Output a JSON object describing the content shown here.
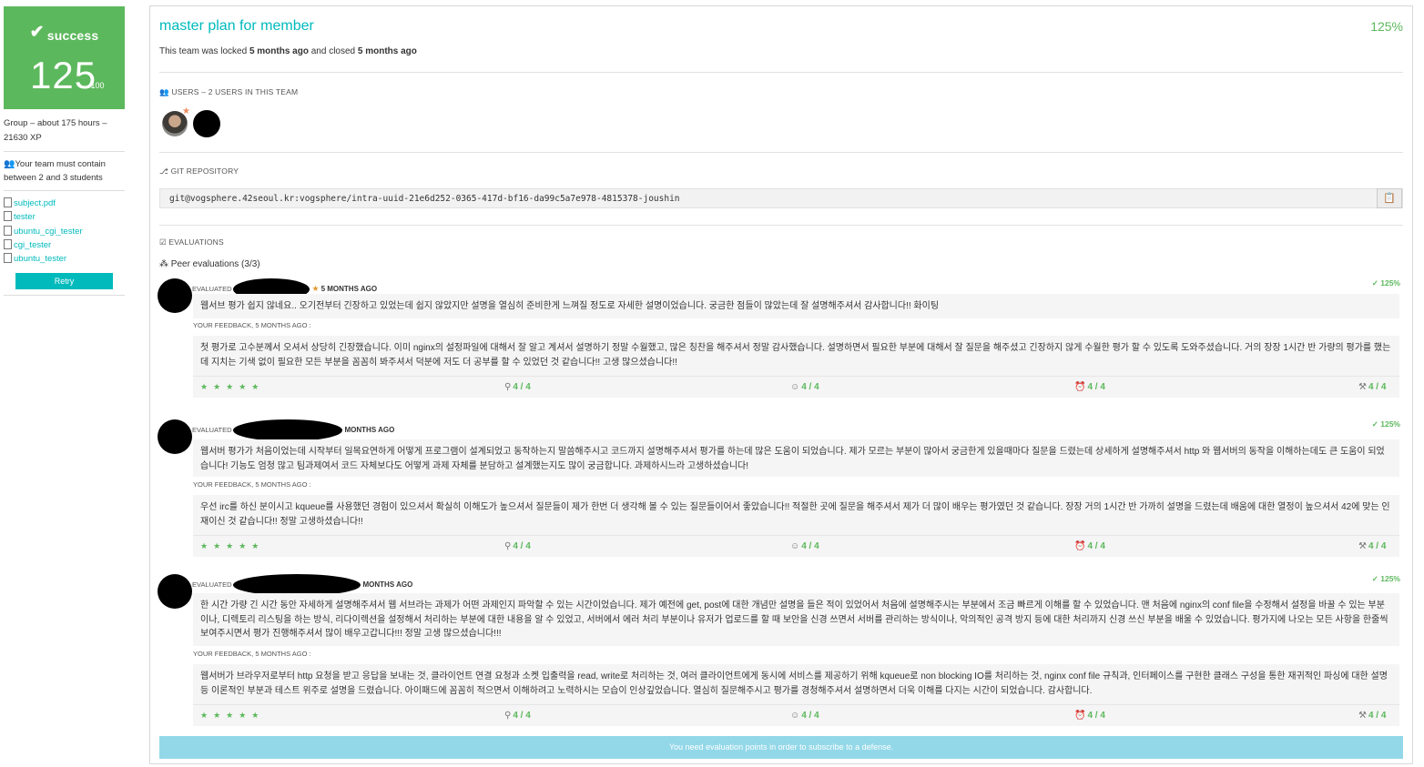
{
  "sidebar": {
    "status": "success",
    "score": "125",
    "score_max": "/100",
    "group_info": "Group – about 175 hours – 21630 XP",
    "team_rule": "Your team must contain between 2 and 3 students",
    "files": [
      "subject.pdf",
      "tester",
      "ubuntu_cgi_tester",
      "cgi_tester",
      "ubuntu_tester"
    ],
    "retry_label": "Retry",
    "colors": {
      "success": "#5cb85c",
      "accent": "#00babc"
    }
  },
  "main": {
    "title": "master plan for member",
    "score": "125%",
    "lock_prefix": "This team was locked ",
    "lock_time": "5 months ago",
    "lock_mid": " and closed ",
    "close_time": "5 months ago",
    "users_label": "USERS – 2 USERS IN THIS TEAM",
    "git_label": "GIT REPOSITORY",
    "git_url": "git@vogsphere.42seoul.kr:vogsphere/intra-uuid-21e6d252-0365-417d-bf16-da99c5a7e978-4815378-joushin",
    "evaluations_label": "EVALUATIONS",
    "peer_title": "Peer evaluations (3/3)",
    "notice": "You need evaluation points in order to subscribe to a defense."
  },
  "evaluations": [
    {
      "header_prefix": "EVALUATED",
      "time": "5 MONTHS AGO",
      "score": "125%",
      "comment": "웹서브 평가 쉽지 않네요.. 오기전부터 긴장하고 있었는데 쉽지 않았지만 설명을 열심히 준비한게 느껴질 정도로 자세한 설명이었습니다. 궁금한 점들이 많았는데 잘 설명해주셔서 감사합니다!! 화이팅",
      "feedback_label": "YOUR FEEDBACK, 5 MONTHS AGO :",
      "feedback": "첫 평가로 고수분께서 오셔서 상당히 긴장했습니다. 이미 nginx의 설정파일에 대해서 잘 알고 계셔서 설명하기 정말 수월했고, 많은 칭찬을 해주셔서 정말 감사했습니다. 설명하면서 필요한 부분에 대해서 잘 질문을 해주셨고 긴장하지 않게 수월한 평가 할 수 있도록 도와주셨습니다. 거의 장장 1시간 반 가량의 평가를 했는데 지치는 기색 없이 필요한 모든 부분을 꼼꼼히 봐주셔서 덕분에 저도 더 공부를 할 수 있었던 것 같습니다!! 고생 많으셨습니다!!",
      "stars": "★★★★★",
      "ratings": [
        "4 / 4",
        "4 / 4",
        "4 / 4",
        "4 / 4"
      ]
    },
    {
      "header_prefix": "EVALUATED",
      "time": "MONTHS AGO",
      "score": "125%",
      "comment": "웹서버 평가가 처음이었는데 시작부터 일목요연하게 어떻게 프로그램이 설계되었고 동작하는지 말씀해주시고 코드까지 설명해주셔서 평가를 하는데 많은 도움이 되었습니다. 제가 모르는 부분이 많아서 궁금한게 있을때마다 질문을 드렸는데 상세하게 설명해주셔서 http 와 웹서버의 동작을 이해하는데도 큰 도움이 되었습니다! 기능도 엄청 많고 팀과제여서 코드 자체보다도 어떻게 과제 자체를 분담하고 설계했는지도 많이 궁금합니다. 과제하시느라 고생하셨습니다!",
      "feedback_label": "YOUR FEEDBACK, 5 MONTHS AGO :",
      "feedback": "우선 irc를 하신 분이시고 kqueue를 사용했던 경험이 있으셔서 확실히 이해도가 높으셔서 질문들이 제가 한번 더 생각해 볼 수 있는 질문들이어서 좋았습니다!! 적절한 곳에 질문을 해주셔서 제가 더 많이 배우는 평가였던 것 같습니다. 장장 거의 1시간 반 가까히 설명을 드렸는데 배움에 대한 열정이 높으셔서 42에 맞는 인재이신 것 같습니다!! 정말 고생하셨습니다!!",
      "stars": "★★★★★",
      "ratings": [
        "4 / 4",
        "4 / 4",
        "4 / 4",
        "4 / 4"
      ]
    },
    {
      "header_prefix": "EVALUATED",
      "time": "MONTHS AGO",
      "score": "125%",
      "comment": "한 시간 가량 긴 시간 동안 자세하게 설명해주셔서 웹 서브라는 과제가 어떤 과제인지 파악할 수 있는 시간이었습니다. 제가 예전에 get, post에 대한 개념만 설명을 들은 적이 있었어서 처음에 설명해주시는 부분에서 조금 빠르게 이해를 할 수 있었습니다. 맨 처음에 nginx의 conf file을 수정해서 설정을 바꿀 수 있는 부분이나, 디렉토리 리스팅을 하는 방식, 리다이렉션을 설정해서 처리하는 부분에 대한 내용을 알 수 있었고, 서버에서 에러 처리 부분이나 유저가 업로드를 할 때 보안을 신경 쓰면서 서버를 관리하는 방식이나, 악의적인 공격 방지 등에 대한 처리까지 신경 쓰신 부분을 배울 수 있었습니다. 평가지에 나오는 모든 사항을 한줄씩 보여주시면서 평가 진행해주셔서 많이 배우고갑니다!!! 정말 고생 많으셨습니다!!!",
      "feedback_label": "YOUR FEEDBACK, 5 MONTHS AGO :",
      "feedback": "웹서버가 브라우저로부터 http 요청을 받고 응답을 보내는 것, 클라이언트 연결 요청과 소켓 입출력을 read, write로 처리하는 것, 여러 클라이언트에게 동시에 서비스를 제공하기 위해 kqueue로 non blocking IO를 처리하는 것, nginx conf file 규칙과, 인터페이스를 구현한 클래스 구성을 통한 재귀적인 파싱에 대한 설명 등 이론적인 부분과 테스트 위주로 설명을 드렸습니다. 아이패드에 꼼꼼히 적으면서 이해하려고 노력하시는 모습이 인상깊었습니다. 열심히 질문해주시고 평가를 경청해주셔서 설명하면서 더욱 이해를 다지는 시간이 되었습니다. 감사합니다.",
      "stars": "★★★★★",
      "ratings": [
        "4 / 4",
        "4 / 4",
        "4 / 4",
        "4 / 4"
      ]
    }
  ]
}
